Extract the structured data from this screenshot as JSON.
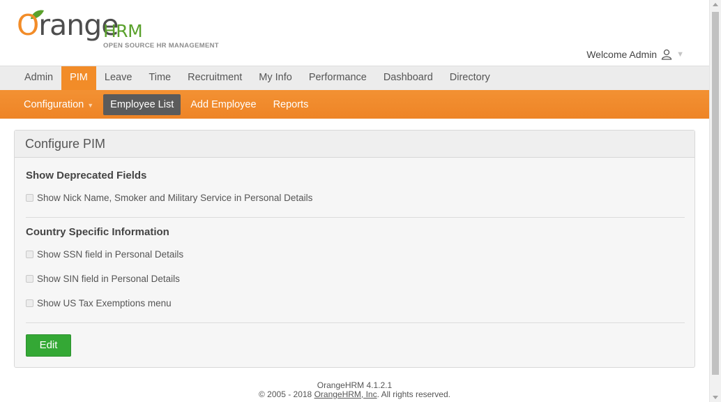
{
  "header": {
    "logo_word_o": "O",
    "logo_word_rest": "range",
    "logo_hrm": "HRM",
    "logo_tagline": "OPEN SOURCE HR MANAGEMENT",
    "welcome_text": "Welcome Admin"
  },
  "main_nav": {
    "items": [
      "Admin",
      "PIM",
      "Leave",
      "Time",
      "Recruitment",
      "My Info",
      "Performance",
      "Dashboard",
      "Directory"
    ],
    "active": "PIM"
  },
  "sub_nav": {
    "configuration": "Configuration",
    "employee_list": "Employee List",
    "add_employee": "Add Employee",
    "reports": "Reports",
    "active": "Employee List"
  },
  "panel": {
    "title": "Configure PIM",
    "deprecated_title": "Show Deprecated Fields",
    "deprecated_option": "Show Nick Name, Smoker and Military Service in Personal Details",
    "country_title": "Country Specific Information",
    "ssn_option": "Show SSN field in Personal Details",
    "sin_option": "Show SIN field in Personal Details",
    "tax_option": "Show US Tax Exemptions menu",
    "edit_label": "Edit"
  },
  "footer": {
    "version": "OrangeHRM 4.1.2.1",
    "copyright_prefix": "© 2005 - 2018",
    "company_link": "OrangeHRM, Inc",
    "copyright_suffix": ". All rights reserved."
  },
  "colors": {
    "brand_orange": "#f28c28",
    "brand_green": "#5aa12c",
    "edit_button": "#34a835",
    "active_subnav": "#5b5b5b"
  }
}
